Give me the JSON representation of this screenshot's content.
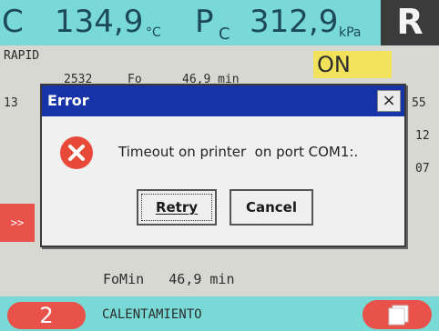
{
  "header": {
    "temp_prefix": "C",
    "temp_value": "134,9",
    "temp_unit": "°C",
    "pressure_prefix": "P",
    "pressure_sub": "C",
    "pressure_value": "312,9",
    "pressure_unit": "kPa",
    "mode_letter": "R"
  },
  "background": {
    "program_name": "RAPID",
    "on_label": "ON",
    "row1_left": "2532",
    "row1_mid": "Fo",
    "row1_right": "46,9 min",
    "left_partial": "13",
    "right_partial_1": "55",
    "right_partial_2": "12",
    "right_partial_3": "07",
    "side_button_label": ">>",
    "fomin_label": "FoMin",
    "fomin_value": "46,9 min"
  },
  "footer": {
    "step_number": "2",
    "status_text": "CALENTAMIENTO",
    "doc_icon": "documents-icon"
  },
  "dialog": {
    "title": "Error",
    "message": "Timeout on printer  on port COM1:.",
    "retry_label": "Retry",
    "cancel_label": "Cancel",
    "close_glyph": "×",
    "icon": "error-icon"
  },
  "colors": {
    "header_bg": "#78d9d6",
    "accent_red": "#e8524a",
    "on_yellow": "#f2e15a",
    "titlebar_blue": "#1733a8"
  }
}
